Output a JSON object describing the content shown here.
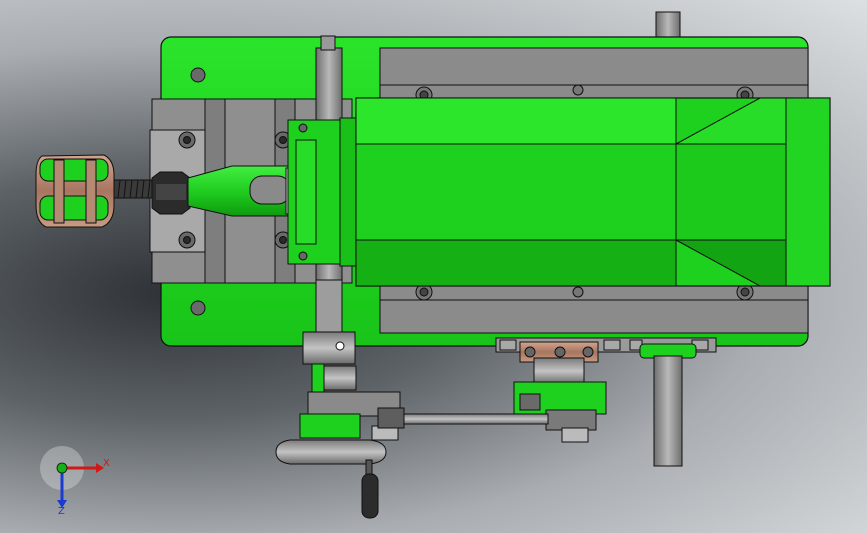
{
  "viewport": {
    "background": {
      "dark": "#2e3236",
      "mid": "#a9adb1",
      "light": "#dde0e3"
    }
  },
  "colors": {
    "green": "#1fd11f",
    "green_dark": "#12a312",
    "green_light": "#3df03d",
    "steel": "#8e8e8e",
    "steel_dark": "#5a5a5a",
    "steel_light": "#b8b8b8",
    "bronze": "#b4846c",
    "outline": "#101010"
  },
  "triad": {
    "x_label": "X",
    "z_label": "Z",
    "x_color": "#d01818",
    "z_color": "#1a3ad0",
    "y_color": "#18b018"
  },
  "icons": [
    "coordinate-triad-icon"
  ]
}
